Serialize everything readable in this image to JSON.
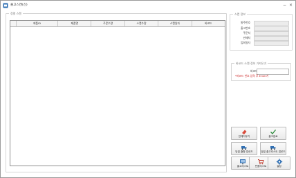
{
  "window": {
    "title": "출고스캔(신)",
    "controls": [
      "−",
      "×"
    ]
  },
  "scan_group": {
    "legend": "정렬 스캔",
    "columns": [
      "제품ID",
      "제품명",
      "주문수량",
      "스캔수량",
      "스캔일자",
      "바코드"
    ]
  },
  "info_group": {
    "legend": "스캔 정보",
    "rows": [
      {
        "label": "발주번호",
        "value": ""
      },
      {
        "label": "출고번호",
        "value": ""
      },
      {
        "label": "주문처",
        "value": ""
      },
      {
        "label": "판매처",
        "value": ""
      },
      {
        "label": "입회일자",
        "value": ""
      }
    ]
  },
  "barcode_group": {
    "legend": "바코드 스캔 정보 가져오기",
    "label": "바코드",
    "value": "",
    "hint": "*바코드 번호 입력 후 Enter키"
  },
  "buttons": {
    "clear": "전체지우기",
    "complete": "출고완료",
    "upload_status": "당일 출항 업로드",
    "upload_detail": "당일 출고리스트 업로드",
    "out_list": "출고리스트",
    "return_list": "반품리스트",
    "settings": "설정"
  },
  "colors": {
    "accent_blue": "#2f6fb3",
    "hint_red": "#cc2222",
    "check_green": "#2a8a3a",
    "eraser_red": "#d94a3a"
  }
}
